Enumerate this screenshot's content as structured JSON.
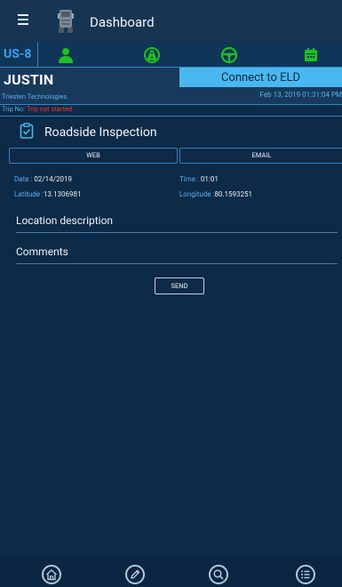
{
  "appbar": {
    "menu_icon": "menu-icon",
    "truck_icon": "truck-icon",
    "title": "Dashboard"
  },
  "tabs": {
    "cycle_label": "US-8",
    "icons": [
      "driver-icon",
      "road-icon",
      "steering-wheel-icon",
      "calendar-icon"
    ],
    "icon_color": "#1fc01f",
    "accent_color": "#3da1f2"
  },
  "driver": {
    "name": "JUSTIN",
    "company": "Triesten Technologies",
    "connect_label": "Connect to ELD",
    "timestamp": "Feb 13, 2019 01:31:04 PM",
    "trip_label": "Trip No:",
    "trip_value": "Trip not started."
  },
  "inspection": {
    "title": "Roadside Inspection",
    "web_label": "WEB",
    "email_label": "EMAIL",
    "date_label": "Date :",
    "date_value": "02/14/2019",
    "time_label": "Time :",
    "time_value": "01:01",
    "lat_label": "Latitude :",
    "lat_value": "13.1306981",
    "lon_label": "Longitude :",
    "lon_value": "80.1593251",
    "location_placeholder": "Location description",
    "comments_placeholder": "Comments",
    "send_label": "SEND"
  },
  "bottom_nav": {
    "items": [
      "home-icon",
      "edit-icon",
      "search-icon",
      "list-icon"
    ]
  }
}
